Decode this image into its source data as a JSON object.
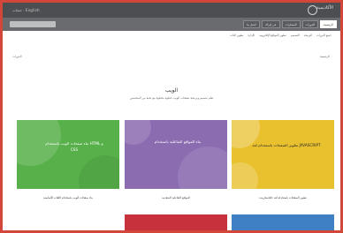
{
  "header": {
    "logo_line1": "الأكاديمية",
    "logo_line2": "edraak",
    "top_left": "حساب · English"
  },
  "tabs": [
    {
      "label": "الرئيسية",
      "active": true
    },
    {
      "label": "الدورات",
      "active": false
    },
    {
      "label": "المسارات",
      "active": false
    },
    {
      "label": "عن إدراك",
      "active": false
    },
    {
      "label": "اتصل بنا",
      "active": false
    }
  ],
  "subnav": [
    "جميع الدورات",
    "البرمجة",
    "التصميم",
    "تطوير المواقع الإلكترونية",
    "الإدارة",
    "تطوير الذات"
  ],
  "breadcrumb": {
    "right": "الرئيسية",
    "left": "الدورات"
  },
  "hero": {
    "title": "الويب",
    "subtitle": "تعلم تصميم وبرمجة صفحات الويب خطوة بخطوة مع نخبة من المختصين"
  },
  "cards": [
    {
      "title": "تطوير الصفحات باستخدام لغة JAVASCRIPT",
      "caption": "تطوير الصفحات باستخدام لغة جافاسكريبت",
      "color": "#e9c12e"
    },
    {
      "title": "بناء المواقع التفاعلية باستخدام",
      "caption": "المواقع التفاعلية المتقدمة",
      "color": "#8c6cb0"
    },
    {
      "title": "بناء صفحات الويب باستخدام HTML و CSS",
      "caption": "بناء صفحات الويب باستخدام اللغات الأساسية",
      "color": "#58b04a"
    }
  ],
  "lower_cards": [
    {
      "color": "#3f7fc4"
    },
    {
      "color": "#c7313b"
    }
  ]
}
